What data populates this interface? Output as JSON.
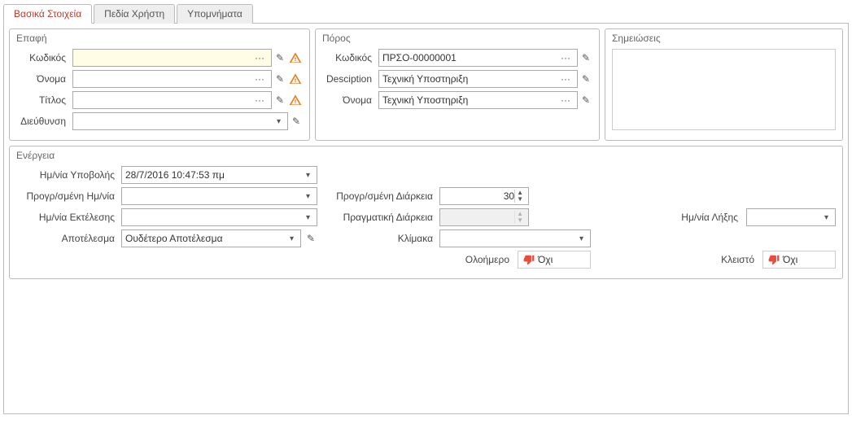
{
  "tabs": {
    "basic": "Βασικά Στοιχεία",
    "user_fields": "Πεδία Χρήστη",
    "reminders": "Υπομνήματα"
  },
  "contact": {
    "title": "Επαφή",
    "code_label": "Κωδικός",
    "code_value": "",
    "name_label": "Όνομα",
    "name_value": "",
    "title_label": "Τίτλος",
    "title_value": "",
    "address_label": "Διεύθυνση",
    "address_value": ""
  },
  "resource": {
    "title": "Πόρος",
    "code_label": "Κωδικός",
    "code_value": "ΠΡΣΟ-00000001",
    "desc_label": "Desciption",
    "desc_value": "Τεχνική Υποστηριξη",
    "name_label": "Όνομα",
    "name_value": "Τεχνική Υποστηριξη"
  },
  "notes": {
    "title": "Σημειώσεις",
    "value": ""
  },
  "action": {
    "title": "Ενέργεια",
    "submit_date_label": "Ημ/νία Υποβολής",
    "submit_date_value": "28/7/2016 10:47:53 πμ",
    "scheduled_date_label": "Προγρ/σμένη Ημ/νία",
    "scheduled_date_value": "",
    "scheduled_duration_label": "Προγρ/σμένη Διάρκεια",
    "scheduled_duration_value": "30",
    "exec_date_label": "Ημ/νία Εκτέλεσης",
    "exec_date_value": "",
    "actual_duration_label": "Πραγματική Διάρκεια",
    "actual_duration_value": "",
    "expiry_date_label": "Ημ/νία Λήξης",
    "expiry_date_value": "",
    "result_label": "Αποτέλεσμα",
    "result_value": "Ουδέτερο Αποτέλεσμα",
    "scale_label": "Κλίμακα",
    "scale_value": "",
    "allday_label": "Ολοήμερο",
    "allday_value": "Όχι",
    "closed_label": "Κλειστό",
    "closed_value": "Όχι"
  },
  "glyphs": {
    "dots": "···",
    "chevron": "▾",
    "pencil": "✎",
    "spin_up": "▲",
    "spin_down": "▼"
  }
}
